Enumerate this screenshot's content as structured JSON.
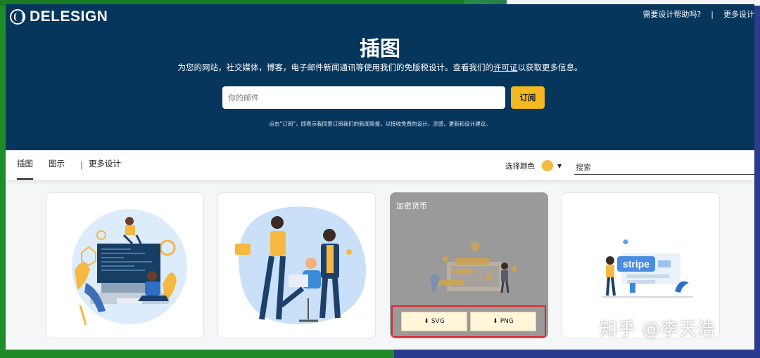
{
  "brand": {
    "name": "DELESIGN"
  },
  "top_links": {
    "help": "需要设计帮助吗?",
    "separator": "|",
    "more": "更多设计"
  },
  "hero": {
    "title": "插图",
    "desc_before": "为您的网站，社交媒体，博客，电子邮件新闻通讯等使用我们的免版税设计。查看我们的",
    "desc_link": "许可证",
    "desc_after": "以获取更多信息。",
    "email_placeholder": "你的邮件",
    "subscribe_label": "订阅",
    "note": "点击“订阅”，即表示我同意订阅我们的新闻简报，以接收免费的设计，灵感，更新和设计建议。"
  },
  "nav": {
    "tabs": [
      {
        "label": "插图"
      },
      {
        "label": "图示"
      },
      {
        "label": "更多设计"
      }
    ],
    "separator": "|",
    "color_label": "选择颜色",
    "color_value": "#f5b942",
    "caret": "▼",
    "search_placeholder": "搜索"
  },
  "cards": [
    {
      "title": "",
      "icon": "developer-illustration"
    },
    {
      "title": "",
      "icon": "team-illustration"
    },
    {
      "title": "加密货币",
      "icon": "crypto-illustration",
      "download": {
        "svg_label": "SVG",
        "png_label": "PNG",
        "icon": "download-icon"
      }
    },
    {
      "title": "",
      "icon": "stripe-illustration",
      "badge_text": "stripe"
    }
  ],
  "watermark": "知乎 @李天浩",
  "colors": {
    "header_bg": "#07365c",
    "accent": "#f4b820",
    "highlight_border": "#e0262b"
  }
}
